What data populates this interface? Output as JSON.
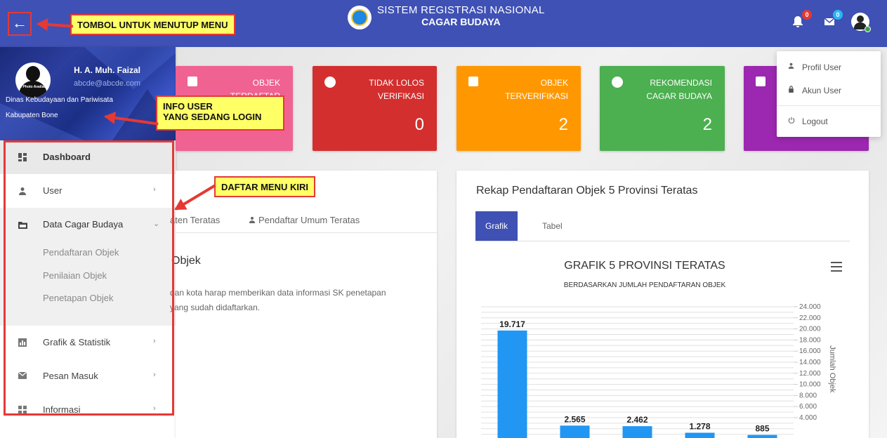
{
  "header": {
    "back_icon": "←",
    "title_line1": "SISTEM REGISTRASI NASIONAL",
    "title_line2": "CAGAR BUDAYA",
    "notif1_count": "0",
    "notif2_count": "0",
    "notif1_color": "#e53935",
    "notif2_color": "#29b6f6"
  },
  "user": {
    "name": "H. A. Muh. Faizal",
    "email": "abcde@abcde.com",
    "org": "Dinas Kebudayaan dan Pariwisata",
    "region": "Kabupaten Bone",
    "no_photo": "No Photo Available"
  },
  "menu": [
    {
      "label": "Dashboard",
      "icon": "dashboard-icon"
    },
    {
      "label": "User",
      "icon": "person-icon"
    },
    {
      "label": "Data Cagar Budaya",
      "icon": "folder-icon"
    },
    {
      "label": "Grafik & Statistik",
      "icon": "chart-icon"
    },
    {
      "label": "Pesan Masuk",
      "icon": "mail-icon"
    },
    {
      "label": "Informasi",
      "icon": "widgets-icon"
    }
  ],
  "submenu": [
    "Pendaftaran Objek",
    "Penilaian Objek",
    "Penetapan Objek"
  ],
  "callouts": {
    "close_menu": "TOMBOL UNTUK MENUTUP MENU",
    "user_info_1": "INFO USER",
    "user_info_2": "YANG SEDANG LOGIN",
    "left_menu": "DAFTAR MENU KIRI"
  },
  "cards": [
    {
      "label1": "OBJEK",
      "label2": "TERDAFTAR",
      "value": "",
      "color": "#f06292"
    },
    {
      "label1": "TIDAK LOLOS",
      "label2": "VERIFIKASI",
      "value": "0",
      "color": "#d32f2f"
    },
    {
      "label1": "OBJEK",
      "label2": "TERVERIFIKASI",
      "value": "2",
      "color": "#ff9800"
    },
    {
      "label1": "REKOMENDASI",
      "label2": "CAGAR BUDAYA",
      "value": "2",
      "color": "#4caf50"
    },
    {
      "label1": "",
      "label2": "",
      "value": "",
      "color": "#9c27b0"
    }
  ],
  "left_panel": {
    "tab1": "aten Teratas",
    "tab2": "Pendaftar Umum Teratas",
    "heading": "Objek",
    "text1": "dan kota harap memberikan data informasi SK penetapan",
    "text2": "yang sudah didaftarkan."
  },
  "right_panel": {
    "title": "Rekap Pendaftaran Objek 5 Provinsi Teratas",
    "tab_active": "Grafik",
    "tab_other": "Tabel"
  },
  "dropdown": {
    "profile": "Profil User",
    "account": "Akun User",
    "logout": "Logout"
  },
  "chart_data": {
    "type": "bar",
    "title": "GRAFIK 5 PROVINSI TERATAS",
    "subtitle": "BERDASARKAN JUMLAH PENDAFTARAN OBJEK",
    "ylabel": "Jumlah Objek",
    "y_axis_position": "right",
    "ylim": [
      0,
      24000
    ],
    "yticks": [
      "4.000",
      "6.000",
      "8.000",
      "10.000",
      "12.000",
      "14.000",
      "16.000",
      "18.000",
      "20.000",
      "22.000",
      "24.000"
    ],
    "ytick_values": [
      4000,
      6000,
      8000,
      10000,
      12000,
      14000,
      16000,
      18000,
      20000,
      22000,
      24000
    ],
    "values": [
      19717,
      2565,
      2462,
      1278,
      885
    ],
    "value_labels": [
      "19.717",
      "2.565",
      "2.462",
      "1.278",
      "885"
    ],
    "color": "#2196f3",
    "grid": true
  }
}
